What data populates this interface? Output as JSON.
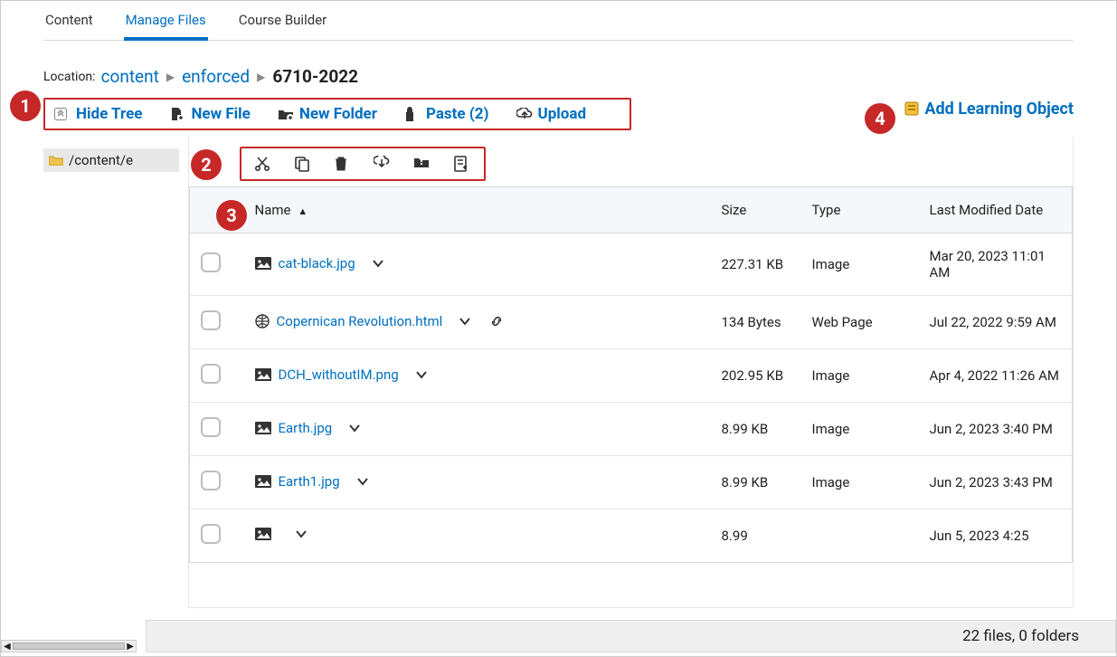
{
  "tabs": {
    "content": "Content",
    "manage_files": "Manage Files",
    "course_builder": "Course Builder"
  },
  "location": {
    "label": "Location:",
    "crumb_content": "content",
    "crumb_enforced": "enforced",
    "crumb_current": "6710-2022"
  },
  "toolbar": {
    "hide_tree": "Hide Tree",
    "new_file": "New File",
    "new_folder": "New Folder",
    "paste": "Paste (2)",
    "upload": "Upload",
    "add_learning_object": "Add Learning Object"
  },
  "tree": {
    "root_path": "/content/e"
  },
  "table": {
    "headers": {
      "name": "Name",
      "size": "Size",
      "type": "Type",
      "modified": "Last Modified Date"
    },
    "rows": [
      {
        "icon": "image",
        "name": "cat-black.jpg",
        "size": "227.31 KB",
        "type": "Image",
        "modified": "Mar 20, 2023 11:01 AM",
        "has_link": false
      },
      {
        "icon": "web",
        "name": "Copernican Revolution.html",
        "size": "134 Bytes",
        "type": "Web Page",
        "modified": "Jul 22, 2022 9:59 AM",
        "has_link": true
      },
      {
        "icon": "image",
        "name": "DCH_withoutIM.png",
        "size": "202.95 KB",
        "type": "Image",
        "modified": "Apr 4, 2022 11:26 AM",
        "has_link": false
      },
      {
        "icon": "image",
        "name": "Earth.jpg",
        "size": "8.99 KB",
        "type": "Image",
        "modified": "Jun 2, 2023 3:40 PM",
        "has_link": false
      },
      {
        "icon": "image",
        "name": "Earth1.jpg",
        "size": "8.99 KB",
        "type": "Image",
        "modified": "Jun 2, 2023 3:43 PM",
        "has_link": false
      },
      {
        "icon": "image",
        "name": "",
        "size": "8.99",
        "type": "",
        "modified": "Jun 5, 2023 4:25",
        "has_link": false
      }
    ]
  },
  "status": {
    "summary": "22 files, 0 folders"
  },
  "annotations": [
    "1",
    "2",
    "3",
    "4"
  ]
}
